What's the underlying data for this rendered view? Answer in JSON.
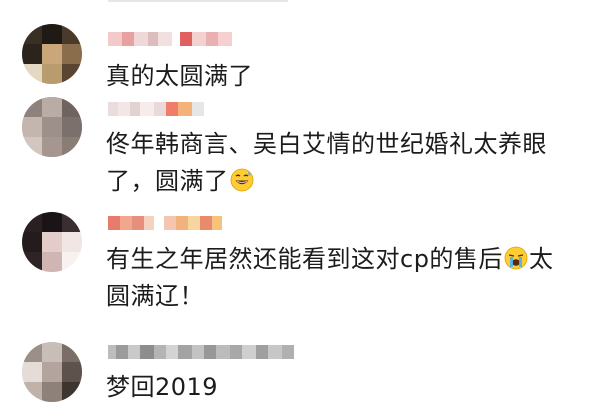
{
  "comments": [
    {
      "username": "",
      "text": "真的太圆满了",
      "avatar": "avatar-dark-portrait"
    },
    {
      "username": "",
      "text_before_emoji": "佟年韩商言、吴白艾情的世纪婚礼太养眼了，圆满了",
      "emoji": "grinning-sweat-emoji",
      "avatar": "avatar-grey-portrait"
    },
    {
      "username": "",
      "text_before_emoji": "有生之年居然还能看到这对cp的售后",
      "emoji": "crying-emoji",
      "text_after_emoji": "太圆满辽！",
      "avatar": "avatar-long-hair-portrait"
    },
    {
      "username": "",
      "text": "梦回2019",
      "avatar": "avatar-light-portrait"
    }
  ],
  "colors": {
    "text": "#1c1c1c",
    "username_pixels": [
      "#f2a3a3",
      "#e66a6a",
      "#f5c28a",
      "#cfcfcf",
      "#9a9a9a"
    ]
  }
}
